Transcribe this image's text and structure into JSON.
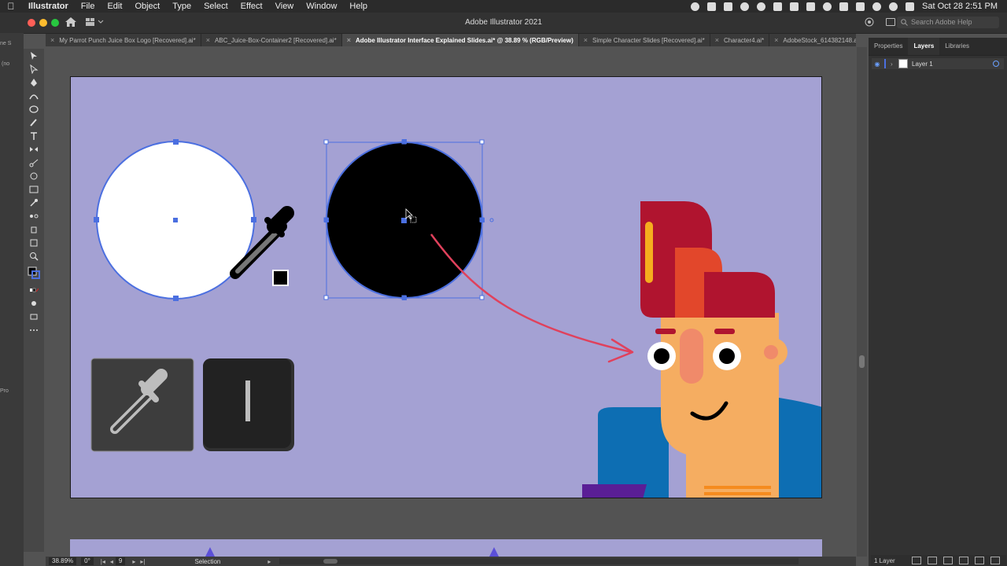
{
  "menubar": {
    "app_name": "Illustrator",
    "items": [
      "File",
      "Edit",
      "Object",
      "Type",
      "Select",
      "Effect",
      "View",
      "Window",
      "Help"
    ],
    "clock": "Sat Oct 28  2:51 PM"
  },
  "titlebar": {
    "title": "Adobe Illustrator 2021",
    "search_placeholder": "Search Adobe Help"
  },
  "tabs": [
    {
      "label": "My Parrot Punch Juice Box Logo [Recovered].ai*",
      "active": false
    },
    {
      "label": "ABC_Juice-Box-Container2 [Recovered].ai*",
      "active": false
    },
    {
      "label": "Adobe Illustrator Interface Explained Slides.ai* @ 38.89 % (RGB/Preview)",
      "active": true
    },
    {
      "label": "Simple Character Slides [Recovered].ai*",
      "active": false
    },
    {
      "label": "Character4.ai*",
      "active": false
    },
    {
      "label": "AdobeStock_614382148.ai",
      "active": false
    }
  ],
  "left_strip": {
    "text1": "ne S",
    "text2": "(no",
    "text3": "Pro"
  },
  "tools": [
    "selection-tool",
    "direct-selection-tool",
    "pen-tool",
    "curvature-tool",
    "ellipse-tool",
    "paintbrush-tool",
    "type-tool",
    "reflect-tool",
    "scissors-tool",
    "warp-tool",
    "gradient-tool",
    "eyedropper-tool",
    "blend-tool",
    "symbol-sprayer-tool",
    "artboard-tool",
    "zoom-tool",
    "fill-stroke-swatch",
    "color-mode",
    "draw-mode",
    "screen-mode",
    "more-tools"
  ],
  "artboard": {
    "shortcut_key": "I",
    "colors": {
      "background": "#a4a1d3",
      "selection": "#4b6fe0",
      "arrow": "#e0415c",
      "hair_dark": "#b0142f",
      "hair_orange": "#e2472b",
      "skin": "#f5ad61",
      "shirt": "#0d6eb3"
    }
  },
  "panel": {
    "tabs": [
      "Properties",
      "Layers",
      "Libraries"
    ],
    "active_tab": "Layers",
    "layer_name": "Layer 1",
    "status": "1 Layer"
  },
  "statusbar": {
    "zoom": "38.89%",
    "rotation": "0°",
    "artboard_number": "9",
    "tool_name": "Selection"
  }
}
